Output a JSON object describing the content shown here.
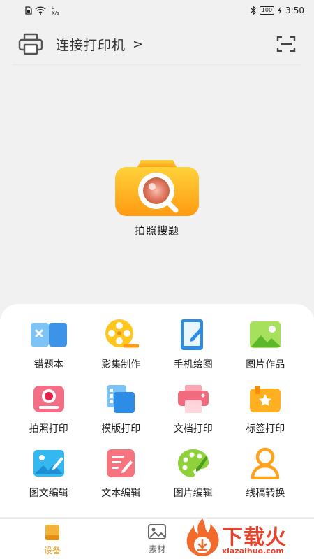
{
  "statusbar": {
    "speed_value": "0",
    "speed_unit": "K/s",
    "battery": "100",
    "time": "3:50"
  },
  "header": {
    "title": "连接打印机"
  },
  "hero": {
    "label": "拍照搜题"
  },
  "tools": [
    {
      "label": "错题本",
      "icon": "wrong-book-icon"
    },
    {
      "label": "影集制作",
      "icon": "film-reel-icon"
    },
    {
      "label": "手机绘图",
      "icon": "tablet-pen-icon"
    },
    {
      "label": "图片作品",
      "icon": "picture-icon"
    },
    {
      "label": "拍照打印",
      "icon": "camera-print-icon"
    },
    {
      "label": "模版打印",
      "icon": "template-icon"
    },
    {
      "label": "文档打印",
      "icon": "printer-icon"
    },
    {
      "label": "标签打印",
      "icon": "label-icon"
    },
    {
      "label": "图文编辑",
      "icon": "image-edit-icon"
    },
    {
      "label": "文本编辑",
      "icon": "text-edit-icon"
    },
    {
      "label": "图片编辑",
      "icon": "palette-icon"
    },
    {
      "label": "线稿转换",
      "icon": "sketch-person-icon"
    }
  ],
  "tabbar": {
    "tabs": [
      {
        "label": "设备",
        "active": true
      },
      {
        "label": "素材",
        "active": false
      }
    ]
  },
  "watermark": {
    "cn": "下载火",
    "en": "xiazaihuo.com"
  },
  "colors": {
    "accent": "#f0a020",
    "watermark": "#e8432c"
  }
}
